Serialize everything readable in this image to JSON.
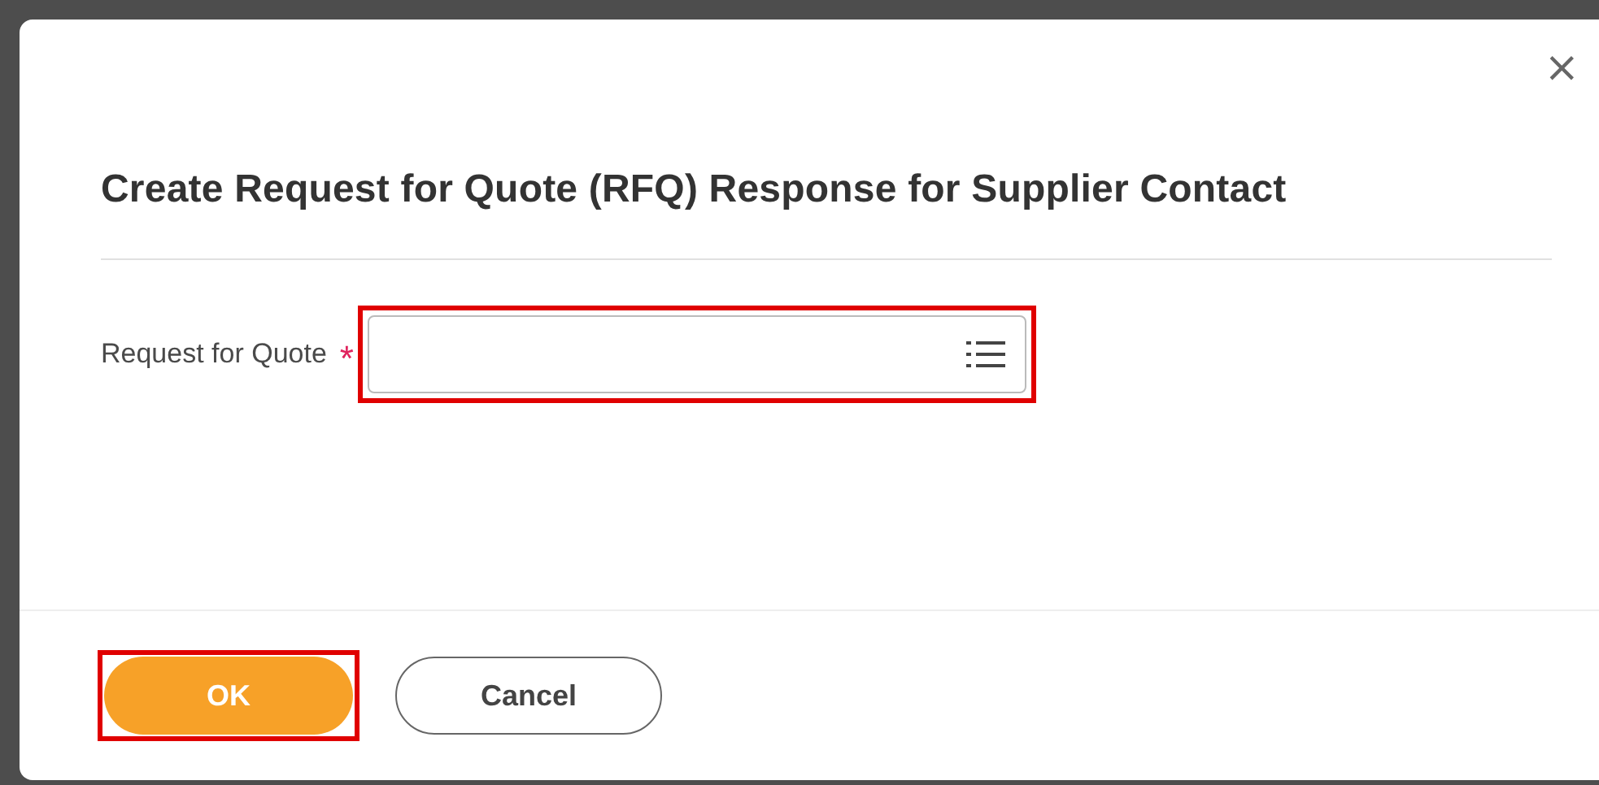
{
  "dialog": {
    "close_symbol": "×",
    "title": "Create Request for Quote (RFQ) Response for Supplier Contact"
  },
  "field": {
    "label": "Request for Quote",
    "required_mark": "*",
    "highlighted": true
  },
  "buttons": [
    {
      "label": "OK",
      "kind": "primary",
      "highlighted": true
    },
    {
      "label": "Cancel",
      "kind": "secondary",
      "highlighted": false
    }
  ]
}
